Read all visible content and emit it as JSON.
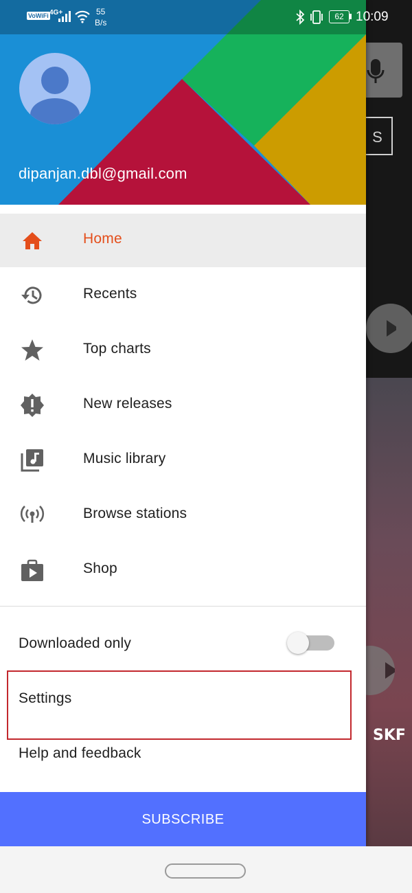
{
  "status_bar": {
    "vowifi": "VoWiFi",
    "network": "4G+",
    "speed_value": "55",
    "speed_unit": "B/s",
    "battery": "62",
    "time": "10:09"
  },
  "drawer": {
    "account_email": "dipanjan.dbl@gmail.com",
    "nav_items": [
      {
        "label": "Home",
        "icon": "home-icon",
        "active": true
      },
      {
        "label": "Recents",
        "icon": "history-icon"
      },
      {
        "label": "Top charts",
        "icon": "star-icon"
      },
      {
        "label": "New releases",
        "icon": "new-releases-icon"
      },
      {
        "label": "Music library",
        "icon": "music-library-icon"
      },
      {
        "label": "Browse stations",
        "icon": "radio-station-icon"
      },
      {
        "label": "Shop",
        "icon": "shop-icon"
      }
    ],
    "downloaded_only": {
      "label": "Downloaded only",
      "enabled": false
    },
    "settings_label": "Settings",
    "help_label": "Help and feedback",
    "subscribe_label": "SUBSCRIBE"
  },
  "background_app": {
    "box_text": "S",
    "logo_text": "SKF"
  },
  "colors": {
    "active": "#e44e1b",
    "subscribe": "#5270ff",
    "highlight_box": "#c2272d",
    "header_blue": "#1a8fd6",
    "header_green": "#16b25b",
    "header_red": "#b5123a",
    "header_yellow": "#cc9c00"
  }
}
